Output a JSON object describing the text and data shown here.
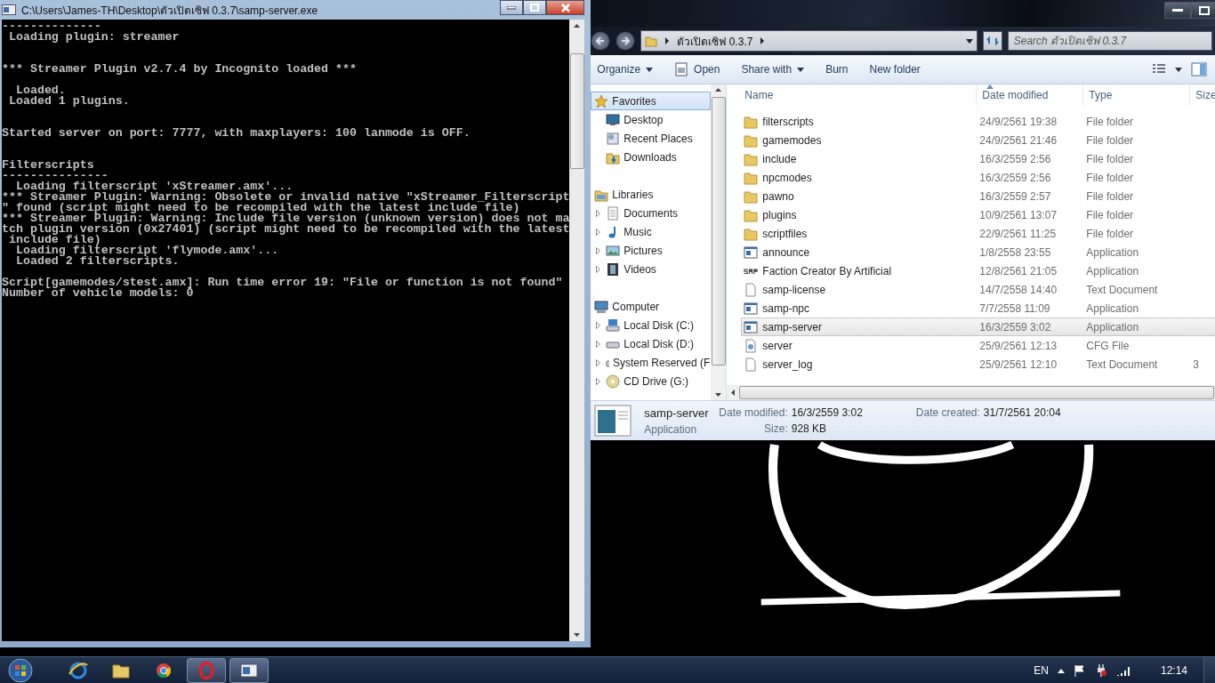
{
  "console": {
    "title": "C:\\Users\\James-TH\\Desktop\\ตัวเปิดเซิฟ 0.3.7\\samp-server.exe",
    "blocks": [
      {
        "kind": "double",
        "lines": [
          "--------------",
          " Loading plugin: streamer"
        ]
      },
      {
        "kind": "single",
        "lines": [
          "*** Streamer Plugin v2.7.4 by Incognito loaded ***"
        ]
      },
      {
        "kind": "double",
        "lines": [
          "  Loaded.",
          " Loaded 1 plugins."
        ]
      },
      {
        "kind": "double",
        "lines": [
          "Started server on port: 7777, with maxplayers: 100 lanmode is OFF."
        ]
      },
      {
        "kind": "single",
        "lines": [
          "Filterscripts",
          "---------------",
          "  Loading filterscript 'xStreamer.amx'...",
          "*** Streamer Plugin: Warning: Obsolete or invalid native \"xStreamer_Filterscript",
          "\" found (script might need to be recompiled with the latest include file)",
          "*** Streamer Plugin: Warning: Include file version (unknown version) does not ma",
          "tch plugin version (0x27401) (script might need to be recompiled with the latest",
          " include file)",
          "  Loading filterscript 'flymode.amx'...",
          "  Loaded 2 filterscripts."
        ]
      },
      {
        "kind": "none",
        "lines": [
          "Script[gamemodes/stest.amx]: Run time error 19: \"File or function is not found\"",
          "Number of vehicle models: 0"
        ]
      }
    ]
  },
  "explorer": {
    "address": "ตัวเปิดเซิฟ 0.3.7",
    "search": {
      "placeholder": "Search ตัวเปิดเซิฟ 0.3.7"
    },
    "toolbar": [
      {
        "label": "Organize",
        "kind": "menu"
      },
      {
        "label": "Open",
        "kind": "icon"
      },
      {
        "label": "Share with",
        "kind": "menu"
      },
      {
        "label": "Burn",
        "kind": "plain"
      },
      {
        "label": "New folder",
        "kind": "plain"
      }
    ],
    "nav": [
      {
        "label": "Favorites",
        "selected": true,
        "children": [
          {
            "label": "Desktop",
            "selected": false
          },
          {
            "label": "Recent Places",
            "selected": false
          },
          {
            "label": "Downloads",
            "selected": false
          }
        ]
      },
      {
        "label": "Libraries",
        "selected": false,
        "children": [
          {
            "label": "Documents",
            "selected": false,
            "expanded": false
          },
          {
            "label": "Music",
            "selected": false,
            "expanded": false
          },
          {
            "label": "Pictures",
            "selected": false,
            "expanded": false
          },
          {
            "label": "Videos",
            "selected": false,
            "expanded": false
          }
        ]
      },
      {
        "label": "Computer",
        "selected": false,
        "children": [
          {
            "label": "Local Disk (C:)",
            "selected": false,
            "expanded": false
          },
          {
            "label": "Local Disk (D:)",
            "selected": false,
            "expanded": false
          },
          {
            "label": "System Reserved (F",
            "selected": false,
            "expanded": false
          },
          {
            "label": "CD Drive (G:)",
            "selected": false,
            "expanded": false
          }
        ]
      }
    ],
    "columns": [
      "Name",
      "Date modified",
      "Type",
      "Size"
    ],
    "files": [
      {
        "name": "filterscripts",
        "date": "24/9/2561 19:38",
        "type": "File folder",
        "kind": "folder",
        "selected": false
      },
      {
        "name": "gamemodes",
        "date": "24/9/2561 21:46",
        "type": "File folder",
        "kind": "folder",
        "selected": false
      },
      {
        "name": "include",
        "date": "16/3/2559 2:56",
        "type": "File folder",
        "kind": "folder",
        "selected": false
      },
      {
        "name": "npcmodes",
        "date": "16/3/2559 2:56",
        "type": "File folder",
        "kind": "folder",
        "selected": false
      },
      {
        "name": "pawno",
        "date": "16/3/2559 2:57",
        "type": "File folder",
        "kind": "folder",
        "selected": false
      },
      {
        "name": "plugins",
        "date": "10/9/2561 13:07",
        "type": "File folder",
        "kind": "folder",
        "selected": false
      },
      {
        "name": "scriptfiles",
        "date": "22/9/2561 11:25",
        "type": "File folder",
        "kind": "folder",
        "selected": false
      },
      {
        "name": "announce",
        "date": "1/8/2558 23:55",
        "type": "Application",
        "kind": "app",
        "selected": false
      },
      {
        "name": "Faction Creator By Artificial",
        "date": "12/8/2561 21:05",
        "type": "Application",
        "kind": "logo",
        "selected": false
      },
      {
        "name": "samp-license",
        "date": "14/7/2558 14:40",
        "type": "Text Document",
        "kind": "text",
        "selected": false
      },
      {
        "name": "samp-npc",
        "date": "7/7/2558 11:09",
        "type": "Application",
        "kind": "app",
        "selected": false
      },
      {
        "name": "samp-server",
        "date": "16/3/2559 3:02",
        "type": "Application",
        "kind": "app",
        "selected": true
      },
      {
        "name": "server",
        "date": "25/9/2561 12:13",
        "type": "CFG File",
        "kind": "cfg",
        "selected": false
      },
      {
        "name": "server_log",
        "date": "25/9/2561 12:10",
        "type": "Text Document",
        "kind": "text",
        "selected": false,
        "size": "3"
      }
    ],
    "details": {
      "name": "samp-server",
      "type": "Application",
      "fields": [
        {
          "label": "Date modified:",
          "value": "16/3/2559 3:02"
        },
        {
          "label": "Date created:",
          "value": "31/7/2561 20:04"
        },
        {
          "label": "Size:",
          "value": "928 KB"
        }
      ]
    }
  },
  "taskbar": {
    "apps": [
      {
        "kind": "ie",
        "selected": false
      },
      {
        "kind": "folder",
        "selected": false
      },
      {
        "kind": "chrome",
        "selected": false
      },
      {
        "kind": "opera",
        "selected": true
      },
      {
        "kind": "console",
        "selected": true
      }
    ],
    "language": "EN",
    "clock": "12:14"
  }
}
